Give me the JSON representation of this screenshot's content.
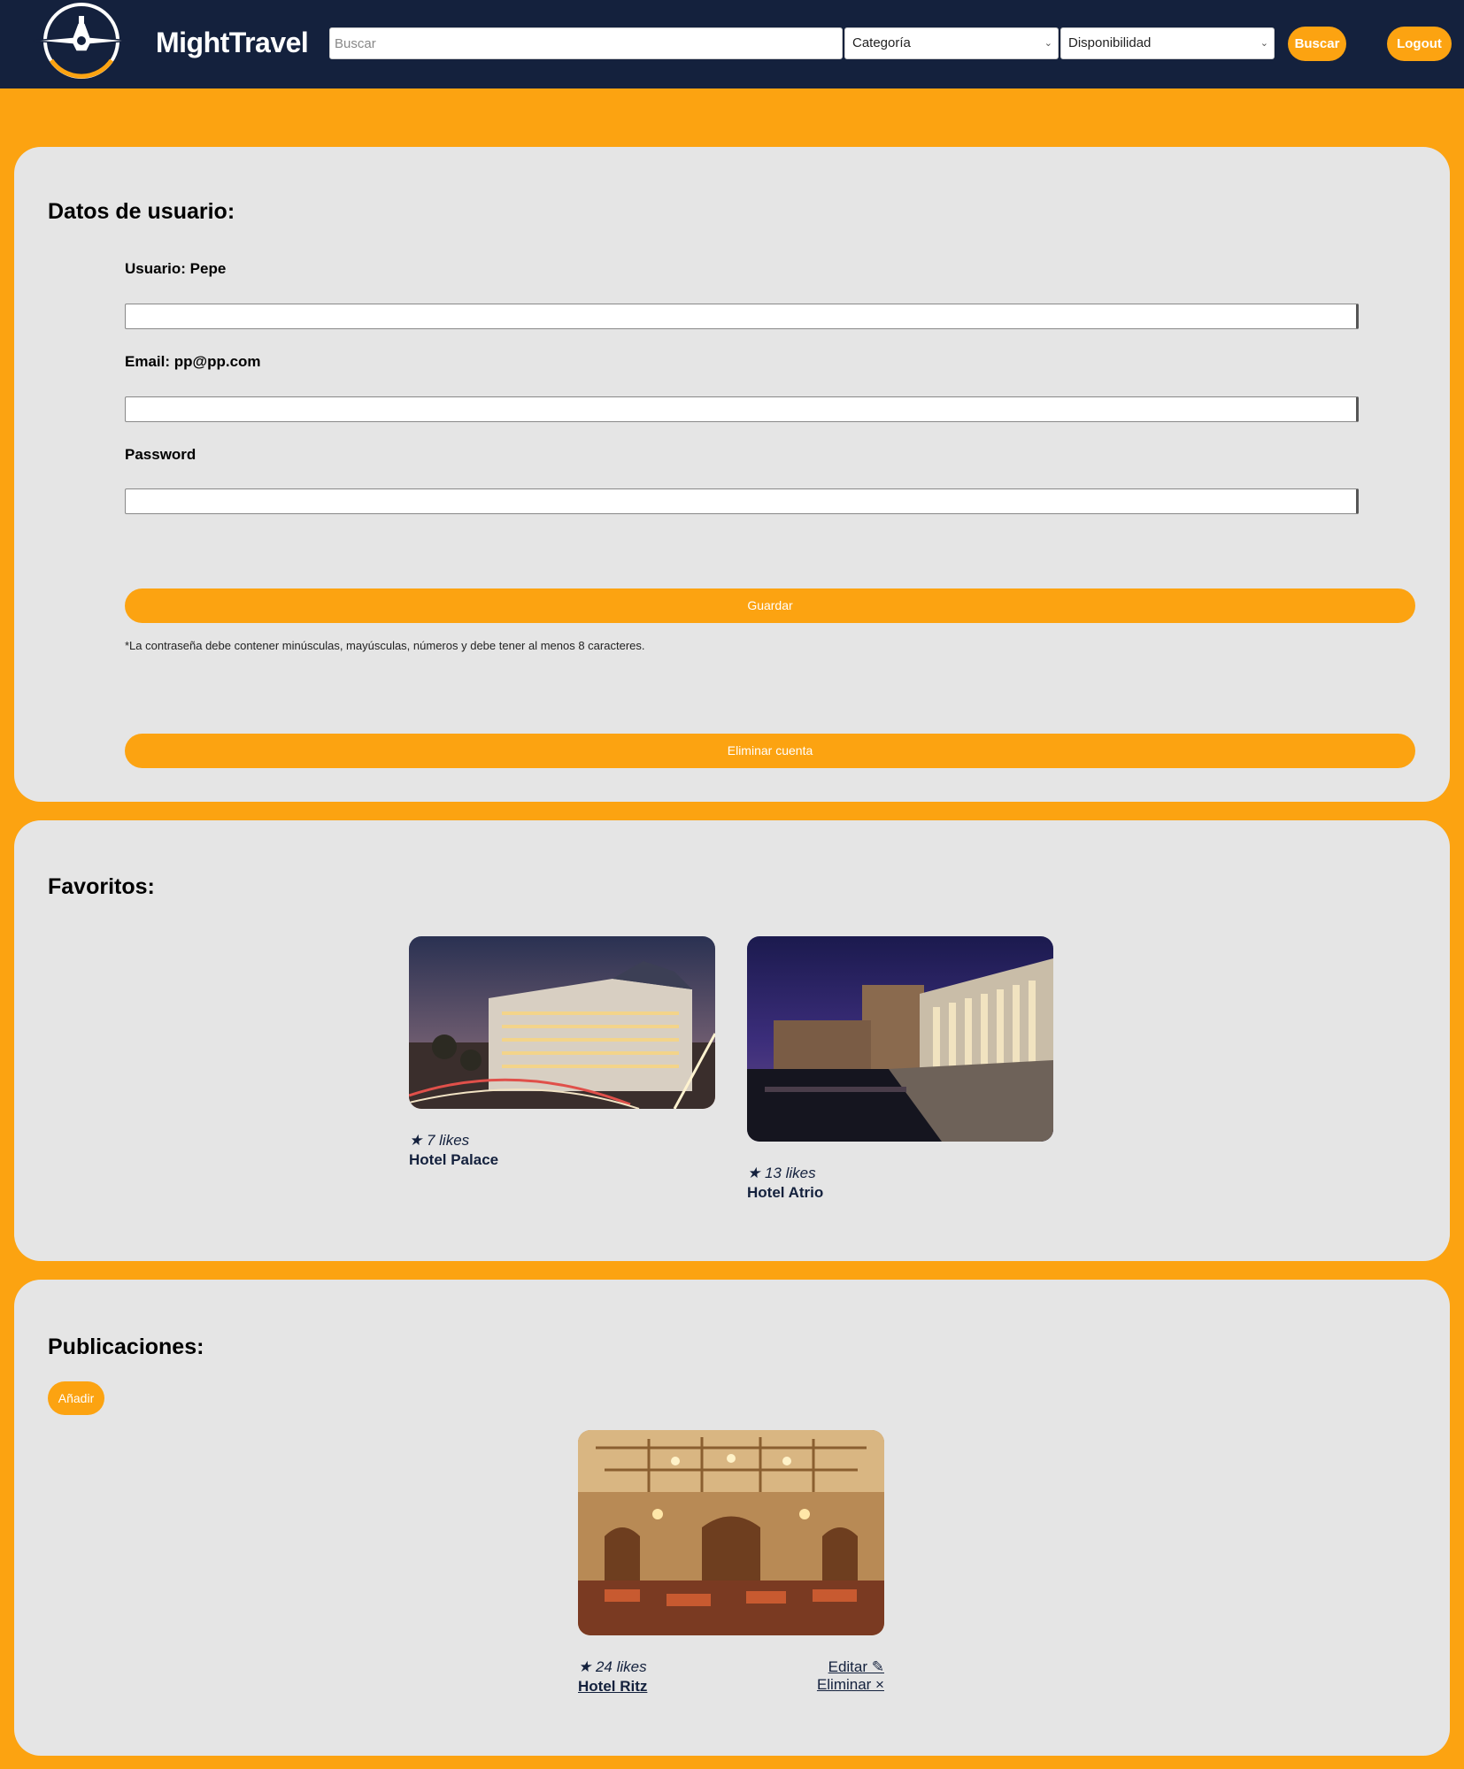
{
  "navbar": {
    "brand": "MightTravel",
    "search_placeholder": "Buscar",
    "category_select": "Categoría",
    "availability_select": "Disponibilidad",
    "search_button": "Buscar",
    "logout_button": "Logout"
  },
  "user_panel": {
    "title": "Datos de usuario:",
    "username_label": "Usuario: Pepe",
    "email_label": "Email: pp@pp.com",
    "password_label": "Password",
    "save_button": "Guardar",
    "password_hint": "*La contraseña debe contener minúsculas, mayúsculas, números y debe tener al menos 8 caracteres.",
    "delete_button": "Eliminar cuenta"
  },
  "favorites": {
    "title": "Favoritos:",
    "items": [
      {
        "likes": "★ 7 likes",
        "name": "Hotel Palace"
      },
      {
        "likes": "★ 13 likes",
        "name": "Hotel Atrio"
      }
    ]
  },
  "publications": {
    "title": "Publicaciones:",
    "add_button": "Añadir",
    "items": [
      {
        "likes": "★ 24 likes",
        "name": "Hotel Ritz",
        "edit": "Editar ✎",
        "delete": "Eliminar ×"
      }
    ]
  },
  "colors": {
    "navy": "#14213d",
    "orange": "#fca311",
    "panel": "#e5e5e5"
  }
}
